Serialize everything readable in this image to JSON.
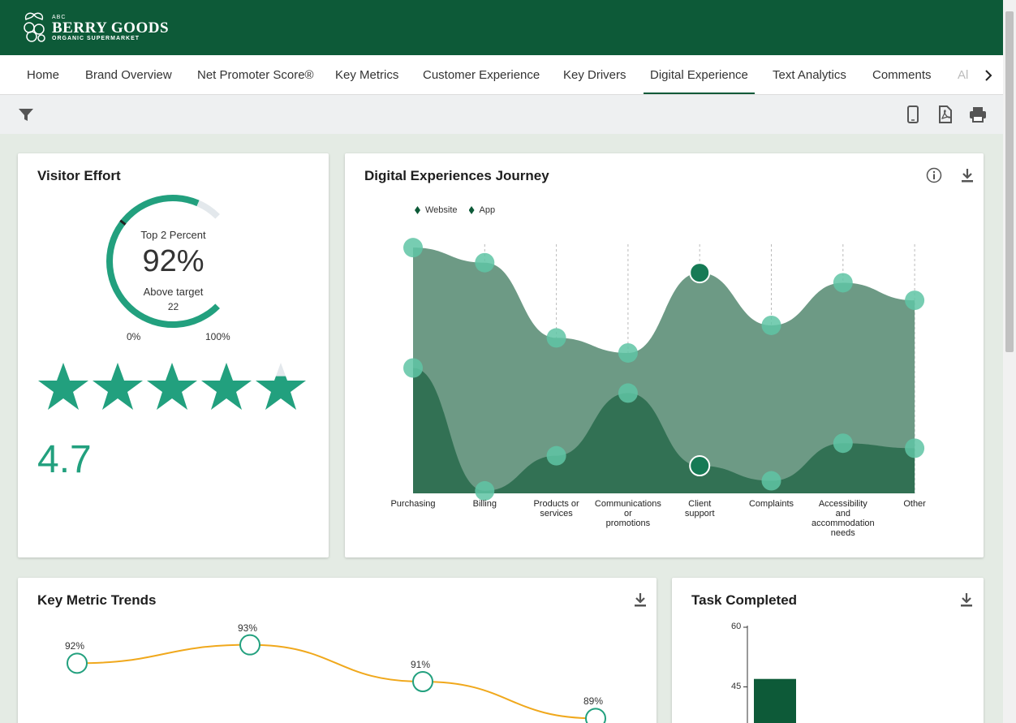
{
  "brand": {
    "abc": "ABC",
    "name": "BERRY GOODS",
    "tagline": "ORGANIC SUPERMARKET"
  },
  "nav": {
    "items": [
      {
        "label": "Home"
      },
      {
        "label": "Brand Overview"
      },
      {
        "label": "Net Promoter Score®"
      },
      {
        "label": "Key Metrics"
      },
      {
        "label": "Customer Experience"
      },
      {
        "label": "Key Drivers"
      },
      {
        "label": "Digital Experience",
        "active": true
      },
      {
        "label": "Text Analytics"
      },
      {
        "label": "Comments"
      }
    ],
    "overflow_label": "Al",
    "next_icon": "chevron-right-icon"
  },
  "toolbar": {
    "filter_icon": "filter-icon",
    "right_icons": [
      "mobile-icon",
      "pdf-icon",
      "print-icon"
    ]
  },
  "visitor_effort": {
    "title": "Visitor Effort",
    "gauge_label": "Top 2 Percent",
    "gauge_value": "92%",
    "gauge_fraction": 0.92,
    "target_label": "Above target",
    "target_value": "22",
    "min_label": "0%",
    "max_label": "100%",
    "rating": "4.7",
    "rating_value": 4.7,
    "stars_max": 5
  },
  "journey": {
    "title": "Digital Experiences Journey",
    "info_icon": "info-icon",
    "download_icon": "download-icon",
    "chart_data": {
      "type": "area",
      "legend_position": "top-left",
      "categories": [
        "Purchasing",
        "Billing",
        "Products or services",
        "Communications or promotions",
        "Client support",
        "Complaints",
        "Accessibility and accommodation needs",
        "Other"
      ],
      "category_lines": [
        [
          "Purchasing"
        ],
        [
          "Billing"
        ],
        [
          "Products or",
          "services"
        ],
        [
          "Communications",
          "or",
          "promotions"
        ],
        [
          "Client",
          "support"
        ],
        [
          "Complaints"
        ],
        [
          "Accessibility",
          "and",
          "accommodation",
          "needs"
        ],
        [
          "Other"
        ]
      ],
      "ylim": [
        0,
        100
      ],
      "series": [
        {
          "name": "Website",
          "values": [
            98,
            92,
            62,
            56,
            88,
            67,
            84,
            77
          ]
        },
        {
          "name": "App",
          "values": [
            50,
            1,
            15,
            40,
            11,
            5,
            20,
            18
          ]
        }
      ]
    }
  },
  "key_metric_trends": {
    "title": "Key Metric Trends",
    "download_icon": "download-icon",
    "chart_data": {
      "type": "line",
      "values": [
        92,
        93,
        91,
        89
      ],
      "labels": [
        "92%",
        "93%",
        "91%",
        "89%"
      ],
      "ylim": [
        88,
        94
      ]
    }
  },
  "task_completed": {
    "title": "Task Completed",
    "download_icon": "download-icon",
    "chart_data": {
      "type": "bar",
      "yticks": [
        "60",
        "45"
      ],
      "ylim": [
        0,
        60
      ],
      "values": [
        47
      ]
    }
  },
  "colors": {
    "brand": "#0d5a38",
    "accent": "#22a07e",
    "website_fill": "#6d9a85",
    "app_fill": "#2e6e50",
    "marker": "#5fc4a4",
    "trend_line": "#f0a81c"
  }
}
